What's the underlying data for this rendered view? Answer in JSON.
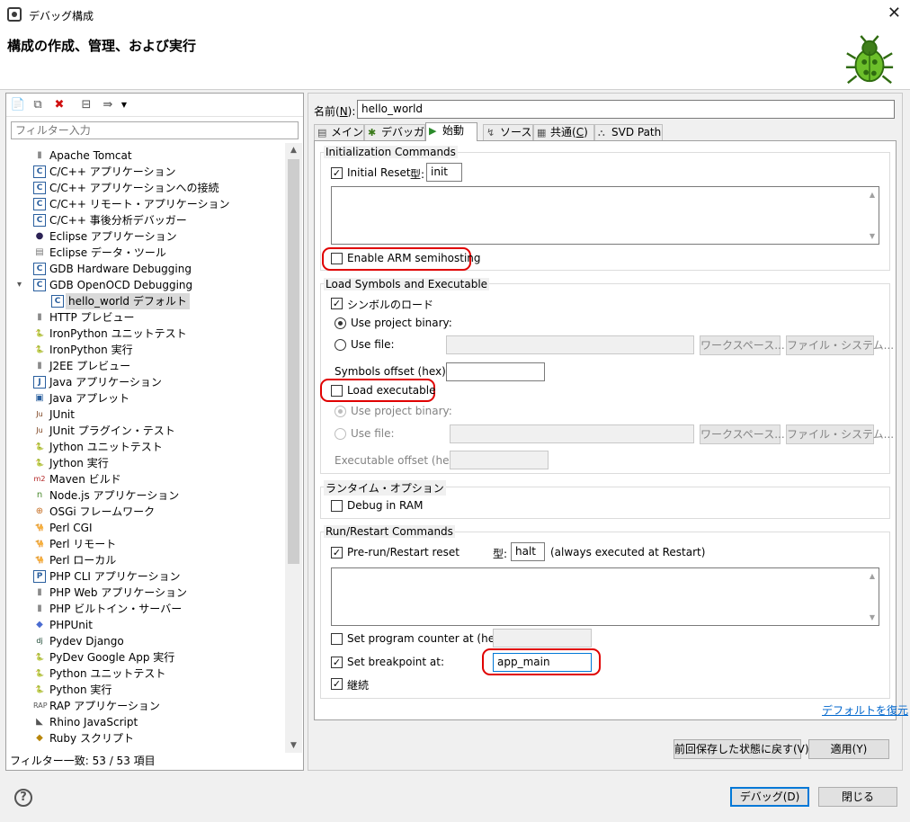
{
  "window": {
    "title": "デバッグ構成",
    "heading": "構成の作成、管理、および実行",
    "close_icon": "close-icon"
  },
  "left": {
    "filter_placeholder": "フィルター入力",
    "status": "フィルター一致: 53 / 53 項目",
    "tree": [
      {
        "label": "Apache Tomcat",
        "icon": "tomcat-icon",
        "glyph": "▮",
        "color": "#8a8a8a"
      },
      {
        "label": "C/C++ アプリケーション",
        "icon": "c-app-icon",
        "glyph": "C",
        "color": "#2a5f9e"
      },
      {
        "label": "C/C++ アプリケーションへの接続",
        "icon": "c-attach-icon",
        "glyph": "C",
        "color": "#2a5f9e"
      },
      {
        "label": "C/C++ リモート・アプリケーション",
        "icon": "c-remote-icon",
        "glyph": "C",
        "color": "#2a5f9e"
      },
      {
        "label": "C/C++ 事後分析デバッガー",
        "icon": "c-postmortem-icon",
        "glyph": "C",
        "color": "#2a5f9e"
      },
      {
        "label": "Eclipse アプリケーション",
        "icon": "eclipse-icon",
        "glyph": "●",
        "color": "#2c2255"
      },
      {
        "label": "Eclipse データ・ツール",
        "icon": "database-icon",
        "glyph": "▤",
        "color": "#777"
      },
      {
        "label": "GDB Hardware Debugging",
        "icon": "c-hw-icon",
        "glyph": "C",
        "color": "#2a5f9e"
      },
      {
        "label": "GDB OpenOCD Debugging",
        "icon": "c-openocd-icon",
        "glyph": "C",
        "color": "#2a5f9e"
      },
      {
        "label": "hello_world デフォルト",
        "icon": "c-config-icon",
        "glyph": "C",
        "color": "#2a5f9e"
      },
      {
        "label": "HTTP プレビュー",
        "icon": "http-icon",
        "glyph": "▮",
        "color": "#8a8a8a"
      },
      {
        "label": "IronPython ユニットテスト",
        "icon": "ironpython-test-icon",
        "glyph": "🐍",
        "color": "#444"
      },
      {
        "label": "IronPython 実行",
        "icon": "ironpython-run-icon",
        "glyph": "🐍",
        "color": "#444"
      },
      {
        "label": "J2EE プレビュー",
        "icon": "j2ee-icon",
        "glyph": "▮",
        "color": "#8a8a8a"
      },
      {
        "label": "Java アプリケーション",
        "icon": "java-app-icon",
        "glyph": "J",
        "color": "#2a5f9e"
      },
      {
        "label": "Java アプレット",
        "icon": "java-applet-icon",
        "glyph": "▣",
        "color": "#2a5f9e"
      },
      {
        "label": "JUnit",
        "icon": "junit-icon",
        "glyph": "Ju",
        "color": "#7a3e1a"
      },
      {
        "label": "JUnit プラグイン・テスト",
        "icon": "junit-plugin-icon",
        "glyph": "Ju",
        "color": "#7a3e1a"
      },
      {
        "label": "Jython ユニットテスト",
        "icon": "jython-test-icon",
        "glyph": "🐍",
        "color": "#444"
      },
      {
        "label": "Jython 実行",
        "icon": "jython-run-icon",
        "glyph": "🐍",
        "color": "#444"
      },
      {
        "label": "Maven ビルド",
        "icon": "maven-icon",
        "glyph": "m2",
        "color": "#b22222"
      },
      {
        "label": "Node.js アプリケーション",
        "icon": "nodejs-icon",
        "glyph": "n",
        "color": "#4b8b2f"
      },
      {
        "label": "OSGi フレームワーク",
        "icon": "osgi-icon",
        "glyph": "⊕",
        "color": "#c46a1d"
      },
      {
        "label": "Perl CGI",
        "icon": "perl-cgi-icon",
        "glyph": "🐪",
        "color": "#2a6aa0"
      },
      {
        "label": "Perl リモート",
        "icon": "perl-remote-icon",
        "glyph": "🐪",
        "color": "#2a6aa0"
      },
      {
        "label": "Perl ローカル",
        "icon": "perl-local-icon",
        "glyph": "🐪",
        "color": "#2a6aa0"
      },
      {
        "label": "PHP CLI アプリケーション",
        "icon": "php-cli-icon",
        "glyph": "P",
        "color": "#2a5f9e"
      },
      {
        "label": "PHP Web アプリケーション",
        "icon": "php-web-icon",
        "glyph": "▮",
        "color": "#8a8a8a"
      },
      {
        "label": "PHP ビルトイン・サーバー",
        "icon": "php-server-icon",
        "glyph": "▮",
        "color": "#8a8a8a"
      },
      {
        "label": "PHPUnit",
        "icon": "phpunit-icon",
        "glyph": "◆",
        "color": "#4a6bd0"
      },
      {
        "label": "Pydev Django",
        "icon": "django-icon",
        "glyph": "dj",
        "color": "#0c3c26"
      },
      {
        "label": "PyDev Google App 実行",
        "icon": "google-app-icon",
        "glyph": "🐍",
        "color": "#3c6eb4"
      },
      {
        "label": "Python ユニットテスト",
        "icon": "python-test-icon",
        "glyph": "🐍",
        "color": "#3c6eb4"
      },
      {
        "label": "Python 実行",
        "icon": "python-run-icon",
        "glyph": "🐍",
        "color": "#3c6eb4"
      },
      {
        "label": "RAP アプリケーション",
        "icon": "rap-icon",
        "glyph": "RAP",
        "color": "#555"
      },
      {
        "label": "Rhino JavaScript",
        "icon": "rhino-icon",
        "glyph": "◣",
        "color": "#555"
      },
      {
        "label": "Ruby スクリプト",
        "icon": "ruby-icon",
        "glyph": "◆",
        "color": "#b8860b"
      }
    ]
  },
  "form": {
    "name_label": "名前(",
    "name_mnemonic": "N",
    "name_label_end": "):",
    "name_value": "hello_world",
    "tabs": [
      {
        "label": "メイン",
        "icon": "main-tab-icon",
        "glyph": "▤"
      },
      {
        "label": "デバッガー",
        "icon": "debugger-tab-icon",
        "glyph": "✱"
      },
      {
        "label": "始動",
        "icon": "startup-tab-icon",
        "glyph": "▶"
      },
      {
        "label": "ソース",
        "icon": "source-tab-icon",
        "glyph": "↯"
      },
      {
        "label": "共通(",
        "mnemonic": "C",
        "end": ")",
        "icon": "common-tab-icon",
        "glyph": "▦"
      },
      {
        "label": "SVD Path",
        "icon": "svd-tab-icon",
        "glyph": "⛬"
      }
    ],
    "init": {
      "group_title": "Initialization Commands",
      "initial_reset": "Initial Reset.",
      "type_label": "型:",
      "type_value": "init",
      "semihosting": "Enable ARM semihosting"
    },
    "load": {
      "group_title": "Load Symbols and Executable",
      "load_symbols": "シンボルのロード",
      "use_project_binary": "Use project binary:",
      "use_file": "Use file:",
      "workspace_btn": "ワークスペース...",
      "filesystem_btn": "ファイル・システム...",
      "symbols_offset": "Symbols offset (hex):",
      "load_executable": "Load executable",
      "exec_use_project_binary": "Use project binary:",
      "exec_use_file": "Use file:",
      "exec_workspace_btn": "ワークスペース...",
      "exec_filesystem_btn": "ファイル・システム...",
      "exec_offset": "Executable offset (hex):"
    },
    "runtime": {
      "group_title": "ランタイム・オプション",
      "debug_in_ram": "Debug in RAM"
    },
    "run": {
      "group_title": "Run/Restart Commands",
      "pre_run_reset": "Pre-run/Restart reset",
      "type_label": "型:",
      "type_value": "halt",
      "always_note": "(always executed at Restart)",
      "set_pc": "Set program counter at (hex):",
      "set_breakpoint": "Set breakpoint at:",
      "breakpoint_value": "app_main",
      "continue": "継続"
    },
    "restore_defaults": "デフォルトを復元",
    "revert_btn": "前回保存した状態に戻す(V)",
    "apply_btn": "適用(Y)"
  },
  "bottom": {
    "debug_btn": "デバッグ(D)",
    "close_btn": "閉じる"
  }
}
